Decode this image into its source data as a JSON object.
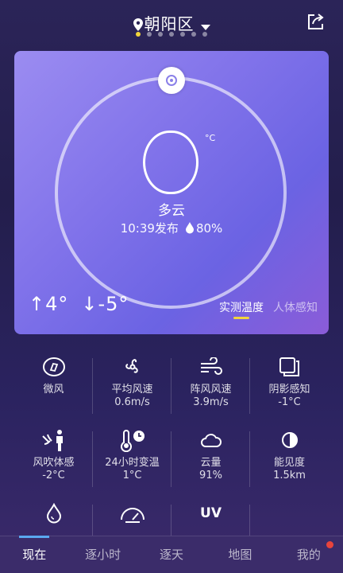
{
  "header": {
    "location": "朝阳区",
    "page_dots": 7,
    "active_dot": 0
  },
  "current": {
    "temp": "0",
    "unit": "°C",
    "condition": "多云",
    "published": "10:39发布",
    "humidity": "80%",
    "high": "↑4°",
    "low": "↓-5°",
    "tabs": [
      "实测温度",
      "人体感知"
    ]
  },
  "details": [
    {
      "label": "微风",
      "value": "",
      "icon": "compass-icon"
    },
    {
      "label": "平均风速",
      "value": "0.6m/s",
      "icon": "fan-icon"
    },
    {
      "label": "阵风风速",
      "value": "3.9m/s",
      "icon": "wind-icon"
    },
    {
      "label": "阴影感知",
      "value": "-1°C",
      "icon": "shadow-icon"
    },
    {
      "label": "风吹体感",
      "value": "-2°C",
      "icon": "person-wind-icon"
    },
    {
      "label": "24小时变温",
      "value": "1°C",
      "icon": "thermometer-clock-icon"
    },
    {
      "label": "云量",
      "value": "91%",
      "icon": "cloud-icon"
    },
    {
      "label": "能见度",
      "value": "1.5km",
      "icon": "visibility-icon"
    },
    {
      "label": "",
      "value": "",
      "icon": "drop-icon"
    },
    {
      "label": "",
      "value": "",
      "icon": "gauge-icon"
    },
    {
      "label": "UV",
      "value": "",
      "icon": "uv-icon"
    },
    {
      "label": "",
      "value": "",
      "icon": ""
    }
  ],
  "nav": [
    "现在",
    "逐小时",
    "逐天",
    "地图",
    "我的"
  ],
  "colors": {
    "accent": "#f2d43b",
    "nav_active": "#5aa8f0",
    "badge": "#e8443c"
  }
}
